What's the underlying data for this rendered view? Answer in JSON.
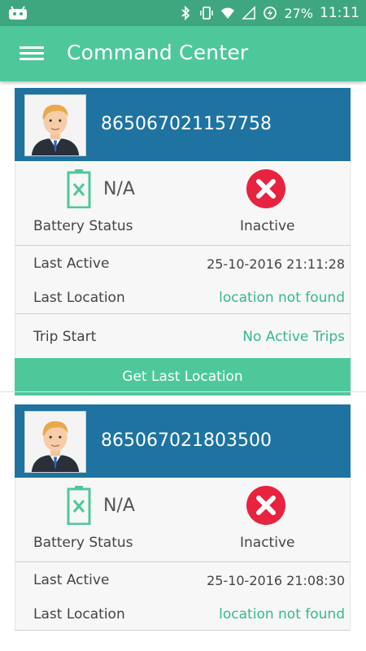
{
  "status_bar": {
    "battery_percent": "27%",
    "time": "11:11"
  },
  "app_bar": {
    "title": "Command Center"
  },
  "devices": [
    {
      "device_id": "865067021157758",
      "battery_value": "N/A",
      "battery_label": "Battery Status",
      "activity_status": "Inactive",
      "last_active_label": "Last Active",
      "last_active_value": "25-10-2016 21:11:28",
      "last_location_label": "Last Location",
      "last_location_value": "location not found",
      "trip_start_label": "Trip Start",
      "trip_start_value": "No Active Trips",
      "button_label": "Get Last Location"
    },
    {
      "device_id": "865067021803500",
      "battery_value": "N/A",
      "battery_label": "Battery Status",
      "activity_status": "Inactive",
      "last_active_label": "Last Active",
      "last_active_value": "25-10-2016 21:08:30",
      "last_location_label": "Last Location",
      "last_location_value": "location not found"
    }
  ],
  "colors": {
    "status_bar": "#3fa780",
    "app_bar": "#4ec89a",
    "card_header": "#1e73a1",
    "inactive_red": "#e8233f",
    "green_text": "#35b98a"
  }
}
